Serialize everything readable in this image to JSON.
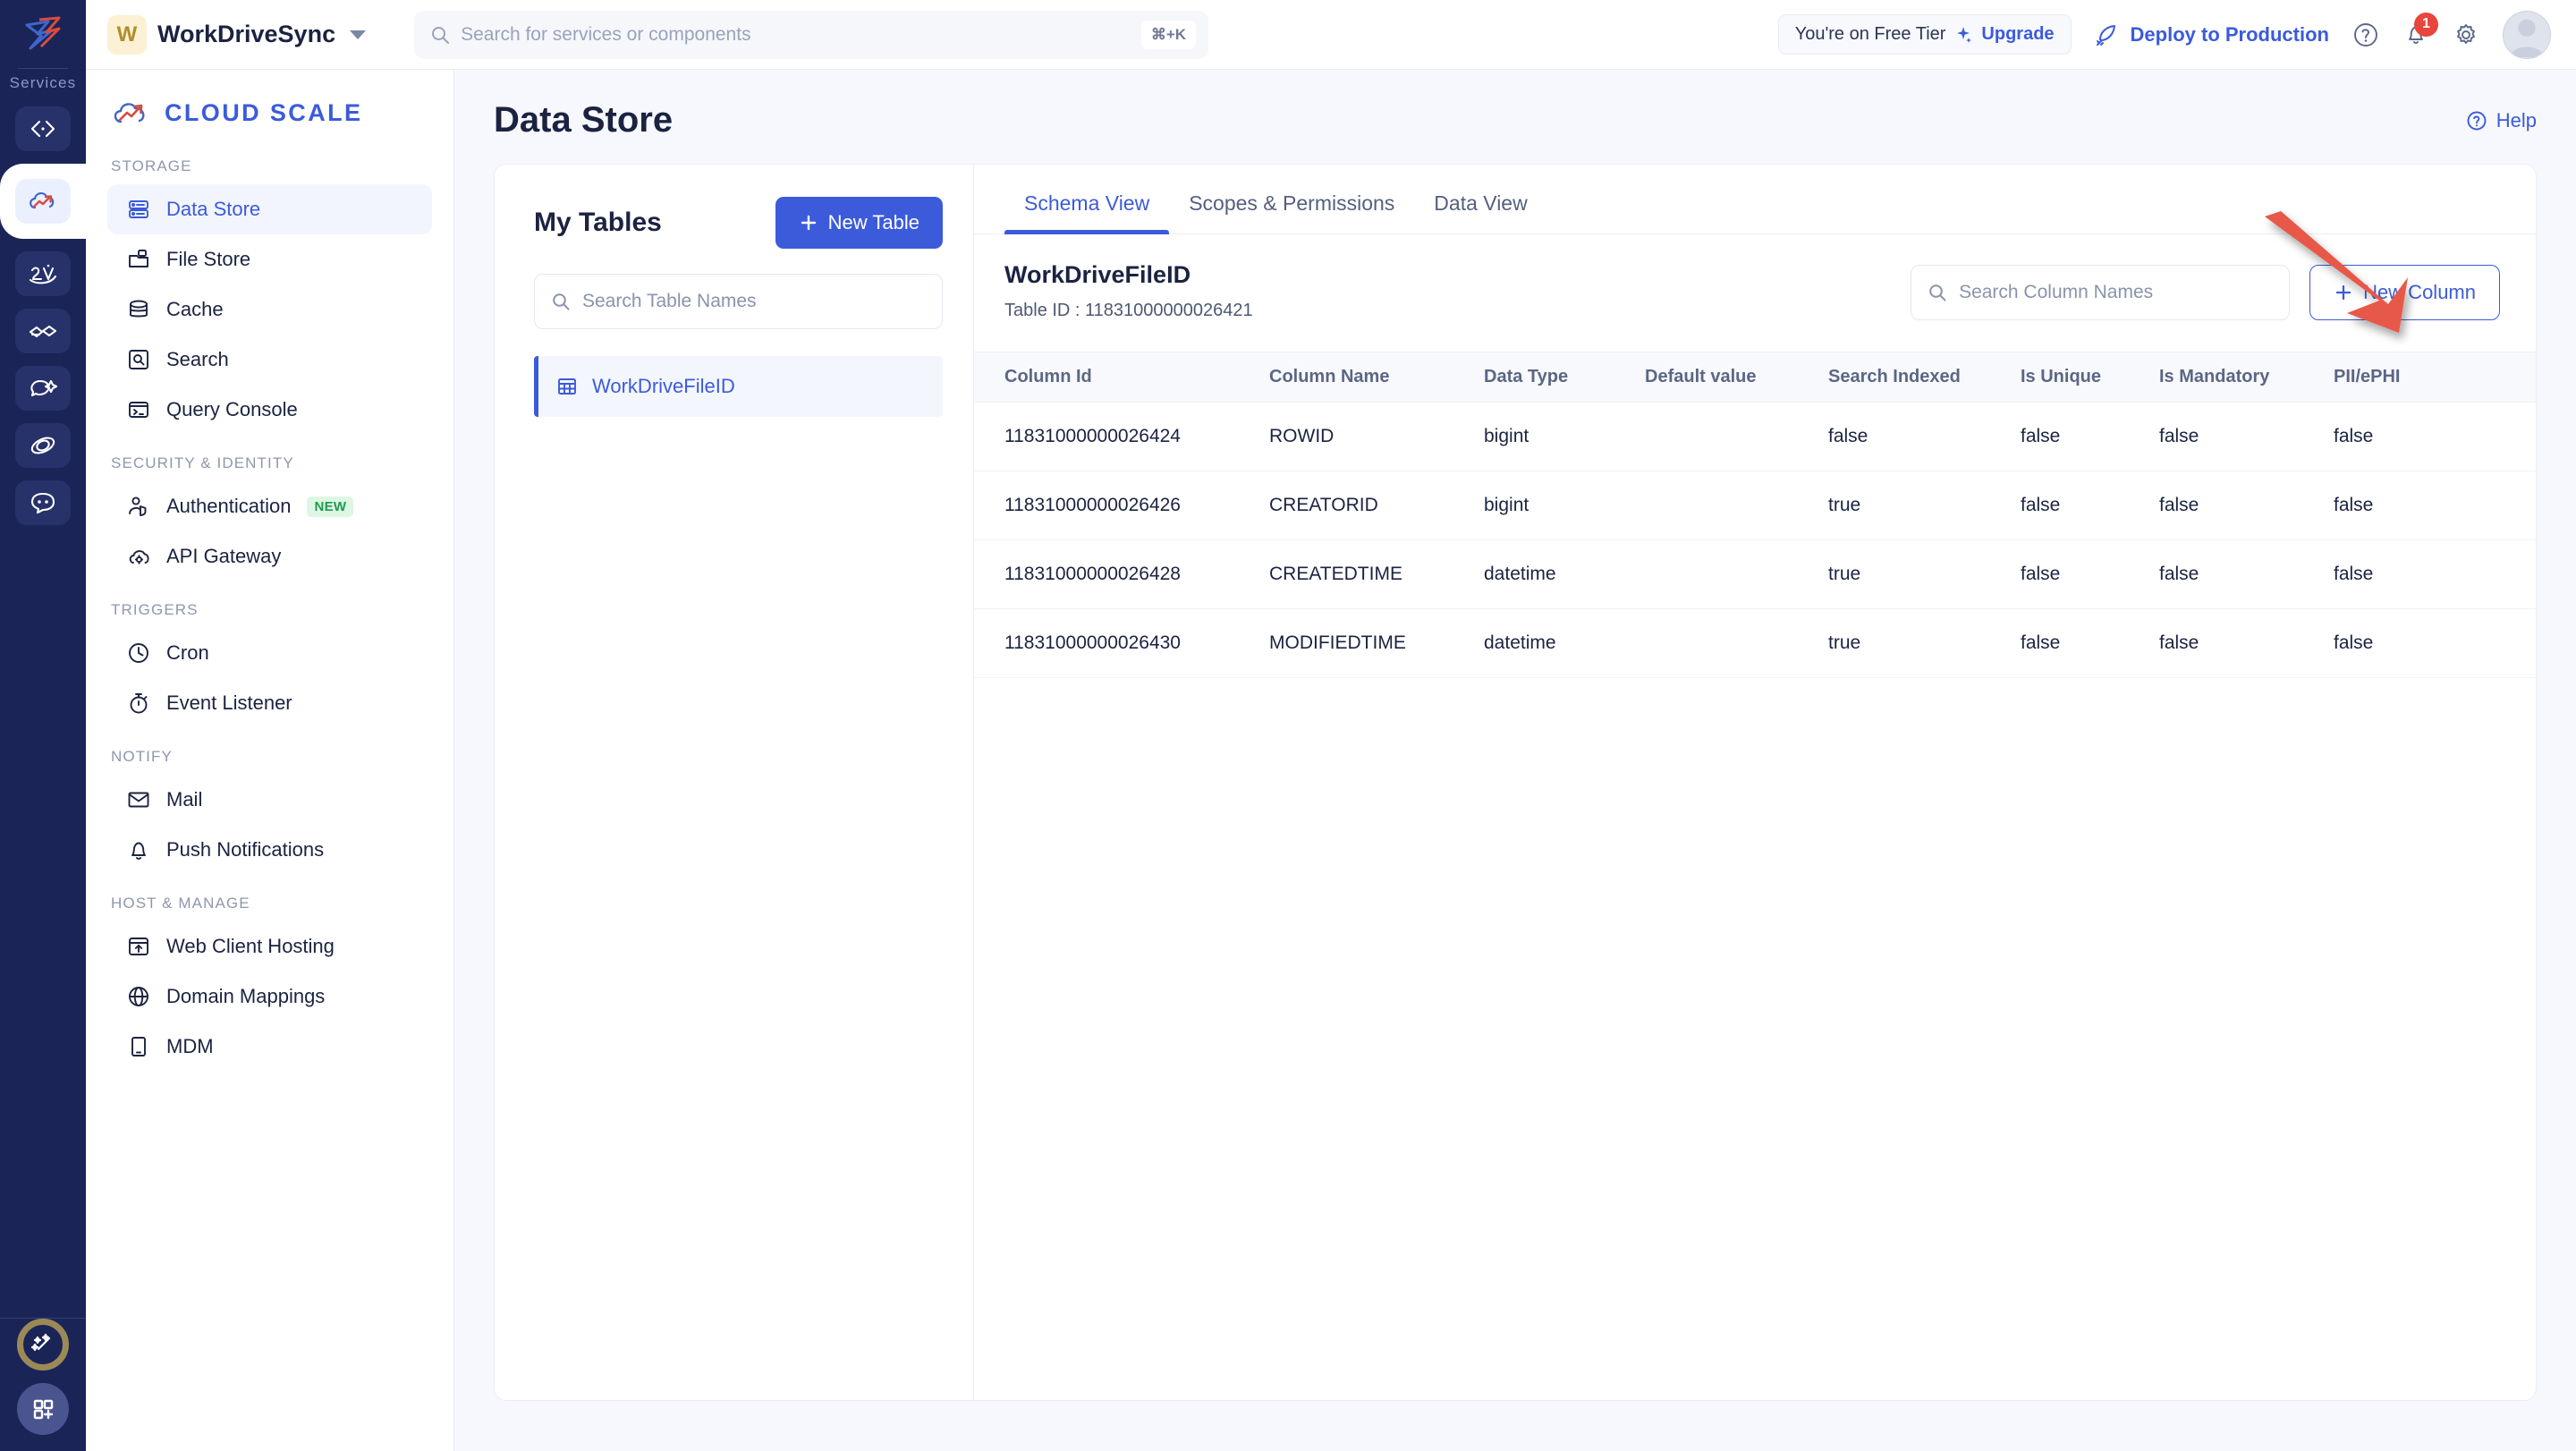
{
  "rail": {
    "label": "Services",
    "items": [
      {
        "name": "code-icon",
        "active": false
      },
      {
        "name": "cloud-scale-icon",
        "active": true
      },
      {
        "name": "analytics-icon",
        "active": false
      },
      {
        "name": "connect-icon",
        "active": false
      },
      {
        "name": "campaign-icon",
        "active": false
      },
      {
        "name": "orbit-icon",
        "active": false
      },
      {
        "name": "chat-icon",
        "active": false
      }
    ],
    "bottom": [
      {
        "name": "magic-wand-icon"
      },
      {
        "name": "app-grid-add-icon"
      }
    ]
  },
  "topbar": {
    "app_badge_letter": "W",
    "app_name": "WorkDriveSync",
    "search_placeholder": "Search for services or components",
    "search_shortcut": "⌘+K",
    "tier_text": "You're on Free Tier",
    "upgrade_label": "Upgrade",
    "deploy_label": "Deploy to Production",
    "notification_count": "1"
  },
  "sidebar": {
    "brand": "CLOUD SCALE",
    "groups": [
      {
        "label": "STORAGE",
        "items": [
          {
            "label": "Data Store",
            "icon": "datastore-icon",
            "active": true
          },
          {
            "label": "File Store",
            "icon": "filestore-icon",
            "active": false
          },
          {
            "label": "Cache",
            "icon": "cache-icon",
            "active": false
          },
          {
            "label": "Search",
            "icon": "search-box-icon",
            "active": false
          },
          {
            "label": "Query Console",
            "icon": "terminal-icon",
            "active": false
          }
        ]
      },
      {
        "label": "SECURITY & IDENTITY",
        "items": [
          {
            "label": "Authentication",
            "icon": "user-shield-icon",
            "active": false,
            "badge": "NEW"
          },
          {
            "label": "API Gateway",
            "icon": "cloud-gear-icon",
            "active": false
          }
        ]
      },
      {
        "label": "TRIGGERS",
        "items": [
          {
            "label": "Cron",
            "icon": "clock-icon",
            "active": false
          },
          {
            "label": "Event Listener",
            "icon": "stopwatch-icon",
            "active": false
          }
        ]
      },
      {
        "label": "NOTIFY",
        "items": [
          {
            "label": "Mail",
            "icon": "mail-icon",
            "active": false
          },
          {
            "label": "Push Notifications",
            "icon": "bell-icon",
            "active": false
          }
        ]
      },
      {
        "label": "HOST & MANAGE",
        "items": [
          {
            "label": "Web Client Hosting",
            "icon": "upload-window-icon",
            "active": false
          },
          {
            "label": "Domain Mappings",
            "icon": "globe-icon",
            "active": false
          },
          {
            "label": "MDM",
            "icon": "mobile-device-icon",
            "active": false
          }
        ]
      }
    ]
  },
  "page": {
    "title": "Data Store",
    "help_label": "Help"
  },
  "tables_panel": {
    "title": "My Tables",
    "new_table_label": "New Table",
    "search_placeholder": "Search Table Names",
    "items": [
      {
        "label": "WorkDriveFileID",
        "selected": true
      }
    ]
  },
  "schema_panel": {
    "tabs": [
      {
        "label": "Schema View",
        "active": true
      },
      {
        "label": "Scopes & Permissions",
        "active": false
      },
      {
        "label": "Data View",
        "active": false
      }
    ],
    "table_name": "WorkDriveFileID",
    "table_id_label": "Table ID : 11831000000026421",
    "column_search_placeholder": "Search Column Names",
    "new_column_label": "New Column",
    "headers": [
      "Column Id",
      "Column Name",
      "Data Type",
      "Default value",
      "Search Indexed",
      "Is Unique",
      "Is Mandatory",
      "PII/ePHI"
    ],
    "rows": [
      {
        "column_id": "11831000000026424",
        "column_name": "ROWID",
        "data_type": "bigint",
        "default_value": "",
        "search_indexed": "false",
        "is_unique": "false",
        "is_mandatory": "false",
        "pii": "false"
      },
      {
        "column_id": "11831000000026426",
        "column_name": "CREATORID",
        "data_type": "bigint",
        "default_value": "",
        "search_indexed": "true",
        "is_unique": "false",
        "is_mandatory": "false",
        "pii": "false"
      },
      {
        "column_id": "11831000000026428",
        "column_name": "CREATEDTIME",
        "data_type": "datetime",
        "default_value": "",
        "search_indexed": "true",
        "is_unique": "false",
        "is_mandatory": "false",
        "pii": "false"
      },
      {
        "column_id": "11831000000026430",
        "column_name": "MODIFIEDTIME",
        "data_type": "datetime",
        "default_value": "",
        "search_indexed": "true",
        "is_unique": "false",
        "is_mandatory": "false",
        "pii": "false"
      }
    ]
  },
  "annotation": {
    "arrow_color": "#e8594a",
    "points_to": "new-column-button"
  },
  "colors": {
    "accent": "#3b5bdb",
    "rail_bg": "#1b2457",
    "page_bg": "#f7f8fd",
    "text": "#1b2341",
    "badge_new": "#1e9b4f",
    "notification": "#e8453c"
  }
}
